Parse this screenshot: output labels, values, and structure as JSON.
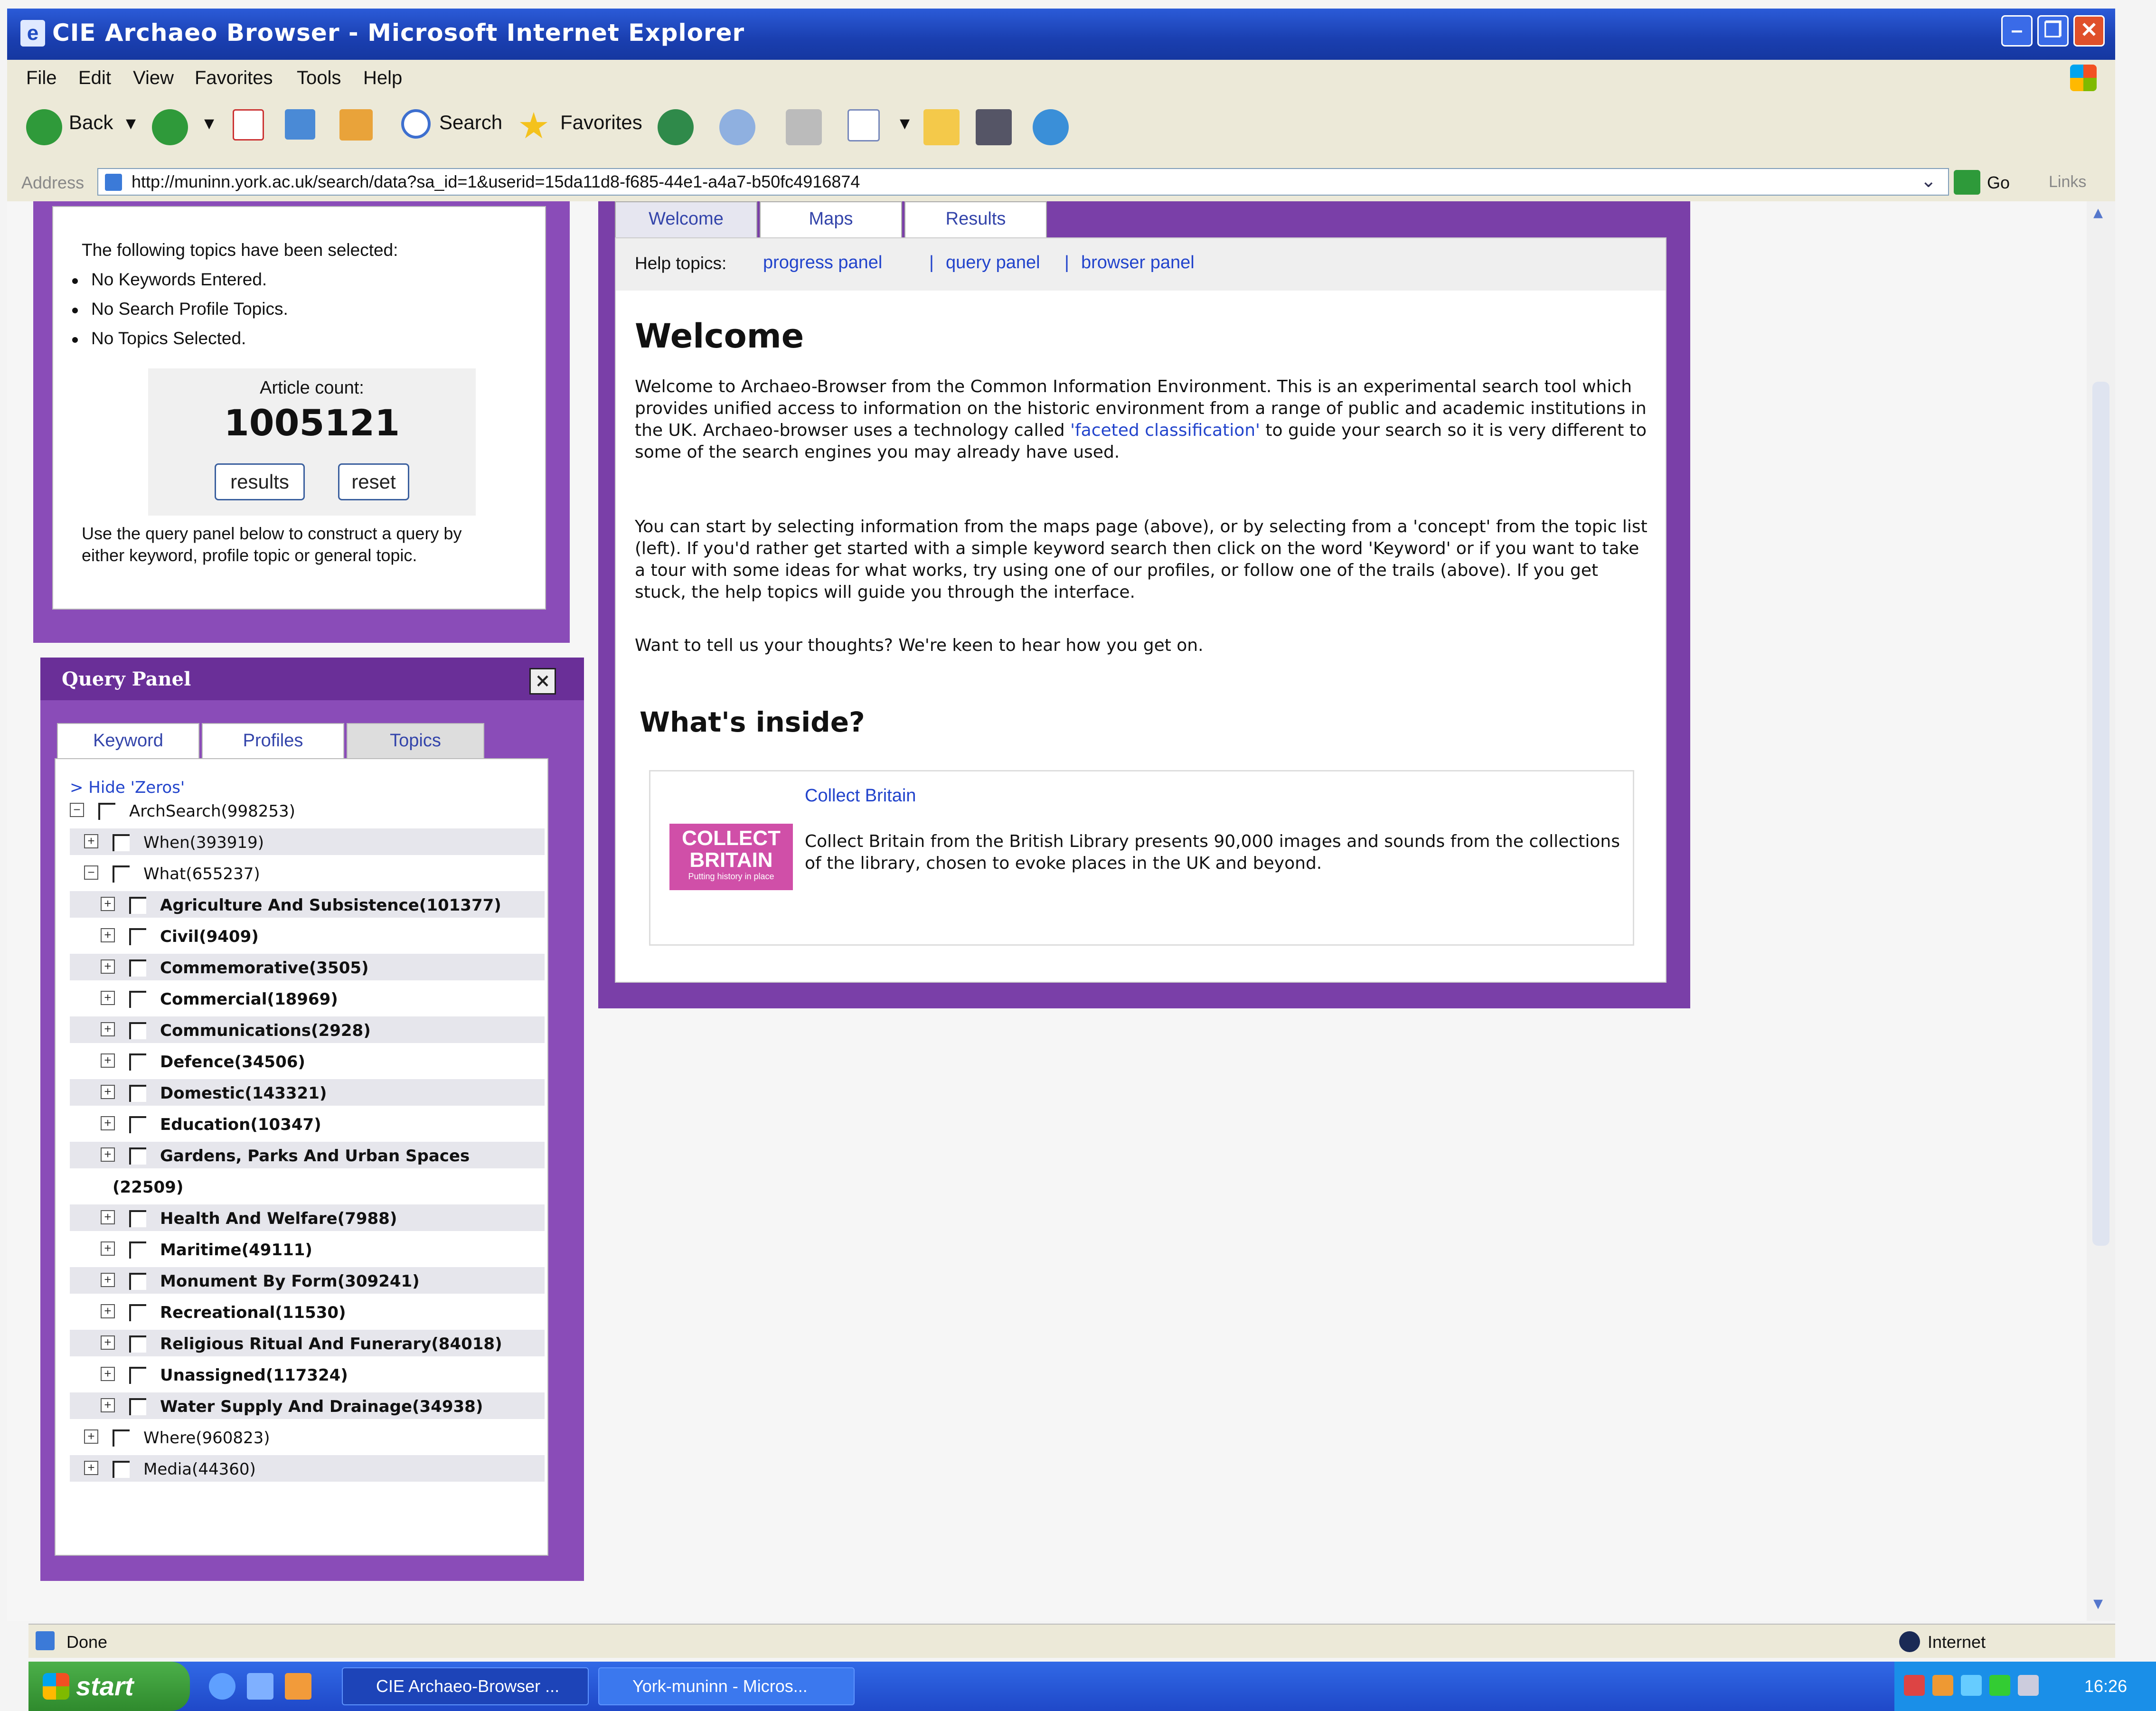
{
  "window": {
    "title": "CIE Archaeo Browser - Microsoft Internet Explorer",
    "minimize": "–",
    "restore": "❐",
    "close": "✕"
  },
  "menu": [
    "File",
    "Edit",
    "View",
    "Favorites",
    "Tools",
    "Help"
  ],
  "toolbar": {
    "back": "Back",
    "search": "Search",
    "favorites": "Favorites"
  },
  "address": {
    "label": "Address",
    "url": "http://muninn.york.ac.uk/search/data?sa_id=1&userid=15da11d8-f685-44e1-a4a7-b50fc4916874",
    "go": "Go",
    "links": "Links"
  },
  "progress_panel": {
    "heading": "The following topics have been selected:",
    "items": [
      "No Keywords Entered.",
      "No Search Profile Topics.",
      "No Topics Selected."
    ],
    "count_label": "Article count:",
    "count_value": "1005121",
    "results_button": "results",
    "reset_button": "reset",
    "hint": "Use the query panel below to construct a query by either keyword, profile topic or general topic."
  },
  "query_panel": {
    "title": "Query Panel",
    "close": "×",
    "tabs": [
      "Keyword",
      "Profiles",
      "Topics"
    ],
    "active_tab": "Topics",
    "hide_zeros": "> Hide 'Zeros'",
    "tree": [
      {
        "label": "ArchSearch(998253)",
        "level": 0,
        "expander": "⊟"
      },
      {
        "label": "When(393919)",
        "level": 1,
        "expander": "⊞"
      },
      {
        "label": "What(655237)",
        "level": 1,
        "expander": "⊟"
      },
      {
        "label": "Agriculture And Subsistence(101377)",
        "level": 2,
        "expander": "⊞"
      },
      {
        "label": "Civil(9409)",
        "level": 2,
        "expander": "⊞"
      },
      {
        "label": "Commemorative(3505)",
        "level": 2,
        "expander": "⊞"
      },
      {
        "label": "Commercial(18969)",
        "level": 2,
        "expander": "⊞"
      },
      {
        "label": "Communications(2928)",
        "level": 2,
        "expander": "⊞"
      },
      {
        "label": "Defence(34506)",
        "level": 2,
        "expander": "⊞"
      },
      {
        "label": "Domestic(143321)",
        "level": 2,
        "expander": "⊞"
      },
      {
        "label": "Education(10347)",
        "level": 2,
        "expander": "⊞"
      },
      {
        "label": "Gardens, Parks And Urban Spaces",
        "level": 2,
        "expander": "⊞"
      },
      {
        "label": "(22509)",
        "level": 9,
        "expander": ""
      },
      {
        "label": "Health And Welfare(7988)",
        "level": 2,
        "expander": "⊞"
      },
      {
        "label": "Maritime(49111)",
        "level": 2,
        "expander": "⊞"
      },
      {
        "label": "Monument By Form(309241)",
        "level": 2,
        "expander": "⊞"
      },
      {
        "label": "Recreational(11530)",
        "level": 2,
        "expander": "⊞"
      },
      {
        "label": "Religious Ritual And Funerary(84018)",
        "level": 2,
        "expander": "⊞"
      },
      {
        "label": "Unassigned(117324)",
        "level": 2,
        "expander": "⊞"
      },
      {
        "label": "Water Supply And Drainage(34938)",
        "level": 2,
        "expander": "⊞"
      },
      {
        "label": "Where(960823)",
        "level": 1,
        "expander": "⊞"
      },
      {
        "label": "Media(44360)",
        "level": 1,
        "expander": "⊞"
      }
    ]
  },
  "main": {
    "tabs": [
      "Welcome",
      "Maps",
      "Results"
    ],
    "help_label": "Help topics:",
    "help_links": [
      "progress panel",
      "query panel",
      "browser panel"
    ],
    "sep": "|",
    "heading": "Welcome",
    "para1_pre": "Welcome to Archaeo-Browser from the Common Information Environment. This is an experimental search tool which provides unified access to information on the historic environment from a range of public and academic institutions in the UK. Archaeo-browser uses a technology called ",
    "para1_link": "'faceted classification'",
    "para1_post": " to guide your search so it is very different to some of the search engines you may already have used.",
    "para2": "You can start by selecting information from the maps page (above), or by selecting from a 'concept' from the topic list (left). If you'd rather get started with a simple keyword search then click on the word 'Keyword' or if you want to take a tour with some ideas for what works, try using one of our profiles, or follow one of the trails (above). If you get stuck, the help topics will guide you through the interface.",
    "para3": "Want to tell us your thoughts? We're keen to hear how you get on.",
    "inside_heading": "What's inside?",
    "collection": {
      "title": "Collect Britain",
      "logo_line1": "COLLECT",
      "logo_line2": "BRITAIN",
      "logo_line3": "Putting history in place",
      "description": "Collect Britain from the British Library presents 90,000 images and sounds from the collections of the library, chosen to evoke places in the UK and beyond."
    }
  },
  "status": {
    "text": "Done",
    "zone": "Internet"
  },
  "taskbar": {
    "start": "start",
    "tasks": [
      "CIE Archaeo-Browser ...",
      "York-muninn - Micros..."
    ],
    "clock": "16:26"
  }
}
